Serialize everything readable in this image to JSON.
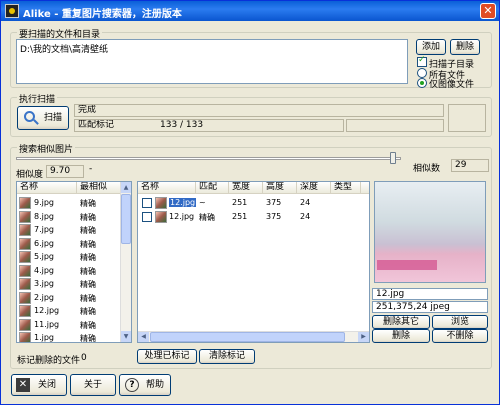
{
  "window": {
    "title": "Alike - 重复图片搜索器，注册版本"
  },
  "scan_target": {
    "group_label": "要扫描的文件和目录",
    "paths": "D:\\我的文档\\高清壁纸",
    "add_button": "添加",
    "delete_button": "删除",
    "scan_subdirs_label": "扫描子目录",
    "scan_subdirs_checked": true,
    "all_files_label": "所有文件",
    "images_only_label": "仅图像文件",
    "selected_filter": "images_only"
  },
  "execute_scan": {
    "group_label": "执行扫描",
    "scan_button": "扫描",
    "status_text": "完成",
    "progress_label": "匹配标记",
    "progress_value": "133 / 133"
  },
  "similar_images": {
    "group_label": "搜索相似图片",
    "similarity_label": "相似度",
    "similarity_value": "9.70",
    "similarity_count_label": "相似数",
    "similarity_count_value": "29"
  },
  "left_list": {
    "columns": [
      "名称",
      "最相似"
    ],
    "rows": [
      {
        "name": "9.jpg",
        "match": "精确"
      },
      {
        "name": "8.jpg",
        "match": "精确"
      },
      {
        "name": "7.jpg",
        "match": "精确"
      },
      {
        "name": "6.jpg",
        "match": "精确"
      },
      {
        "name": "5.jpg",
        "match": "精确"
      },
      {
        "name": "4.jpg",
        "match": "精确"
      },
      {
        "name": "3.jpg",
        "match": "精确"
      },
      {
        "name": "2.jpg",
        "match": "精确"
      },
      {
        "name": "12.jpg",
        "match": "精确"
      },
      {
        "name": "11.jpg",
        "match": "精确"
      },
      {
        "name": "1.jpg",
        "match": "精确"
      }
    ]
  },
  "right_list": {
    "columns": [
      "名称",
      "匹配",
      "宽度",
      "高度",
      "深度",
      "类型"
    ],
    "rows": [
      {
        "name": "12.jpg",
        "match": "~",
        "width": "251",
        "height": "375",
        "depth": "24",
        "type": ""
      },
      {
        "name": "12.jpg",
        "match": "精确",
        "width": "251",
        "height": "375",
        "depth": "24",
        "type": ""
      }
    ]
  },
  "preview": {
    "file_name": "12.jpg",
    "info": "251,375,24 jpeg",
    "delete_others_button": "删除其它",
    "browse_button": "浏览",
    "delete_button": "删除",
    "keep_button": "不删除"
  },
  "marked": {
    "label": "标记删除的文件",
    "count": "0",
    "process_button": "处理已标记",
    "clear_button": "清除标记"
  },
  "footer": {
    "close_button": "关闭",
    "about_button": "关于",
    "help_button": "帮助"
  }
}
